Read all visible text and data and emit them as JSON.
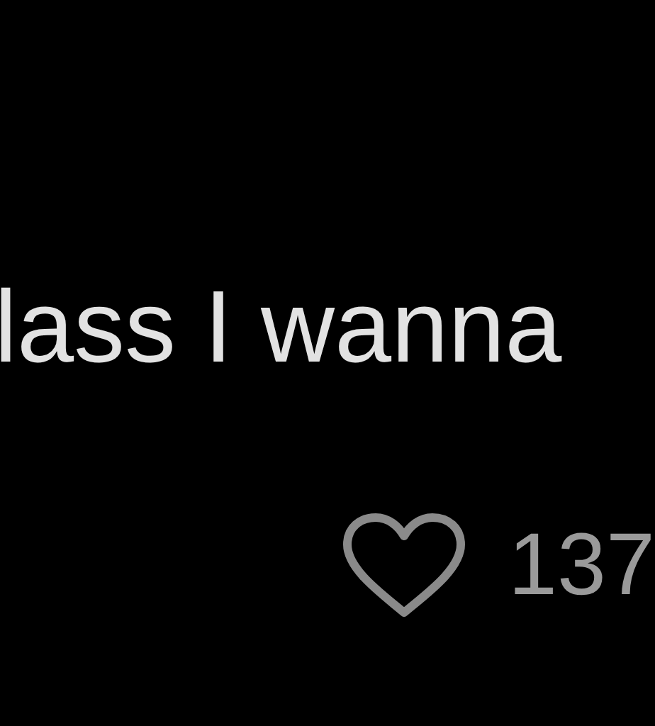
{
  "post": {
    "text": "lass I wanna"
  },
  "likes": {
    "liked": false,
    "count": "137"
  }
}
